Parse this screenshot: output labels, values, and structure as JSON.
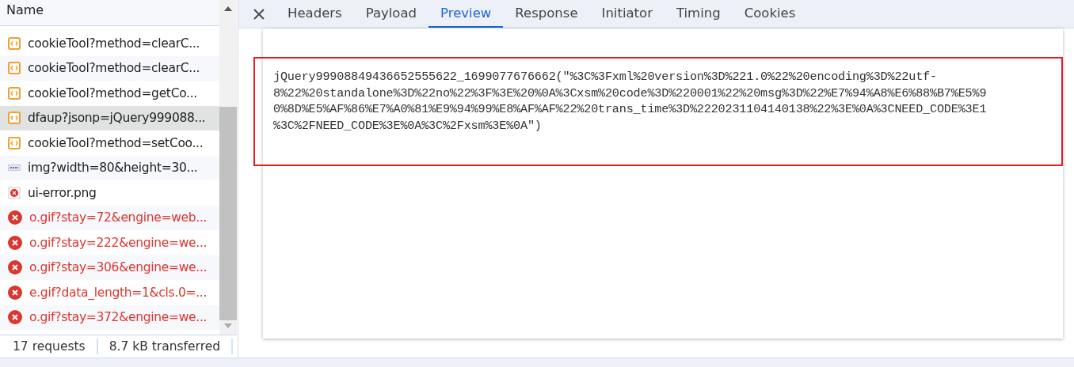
{
  "requests": {
    "column": "Name",
    "rows": [
      {
        "name": "cookieTool?method=clearC...",
        "kind": "script",
        "selected": false
      },
      {
        "name": "cookieTool?method=clearC...",
        "kind": "script",
        "selected": false
      },
      {
        "name": "cookieTool?method=getCo...",
        "kind": "script",
        "selected": false
      },
      {
        "name": "dfaup?jsonp=jQuery999088...",
        "kind": "script",
        "selected": true
      },
      {
        "name": "cookieTool?method=setCoo...",
        "kind": "script",
        "selected": false
      },
      {
        "name": "img?width=80&height=30...",
        "kind": "image",
        "selected": false
      },
      {
        "name": "ui-error.png",
        "kind": "broken-image",
        "selected": false
      },
      {
        "name": "o.gif?stay=72&engine=web...",
        "kind": "failed",
        "selected": false
      },
      {
        "name": "o.gif?stay=222&engine=we...",
        "kind": "failed",
        "selected": false
      },
      {
        "name": "o.gif?stay=306&engine=we...",
        "kind": "failed",
        "selected": false
      },
      {
        "name": "e.gif?data_length=1&cls.0=...",
        "kind": "failed",
        "selected": false
      },
      {
        "name": "o.gif?stay=372&engine=we...",
        "kind": "failed",
        "selected": false
      }
    ],
    "status": [
      "17 requests",
      "8.7 kB transferred"
    ]
  },
  "tabs": [
    {
      "label": "Headers",
      "selected": false
    },
    {
      "label": "Payload",
      "selected": false
    },
    {
      "label": "Preview",
      "selected": true
    },
    {
      "label": "Response",
      "selected": false
    },
    {
      "label": "Initiator",
      "selected": false
    },
    {
      "label": "Timing",
      "selected": false
    },
    {
      "label": "Cookies",
      "selected": false
    }
  ],
  "preview": {
    "lines": [
      "jQuery99908849436652555622_1699077676662(\"%3C%3Fxml%20version%3D%221.0%22%20encoding%3D%22utf-",
      "8%22%20standalone%3D%22no%22%3F%3E%20%0A%3Cxsm%20code%3D%220001%22%20msg%3D%22%E7%94%A8%E6%88%B7%E5%9",
      "0%8D%E5%AF%86%E7%A0%81%E9%94%99%E8%AF%AF%22%20trans_time%3D%2220231104140138%22%3E%0A%3CNEED_CODE%3E1",
      "%3C%2FNEED_CODE%3E%0A%3C%2Fxsm%3E%0A\")"
    ]
  }
}
